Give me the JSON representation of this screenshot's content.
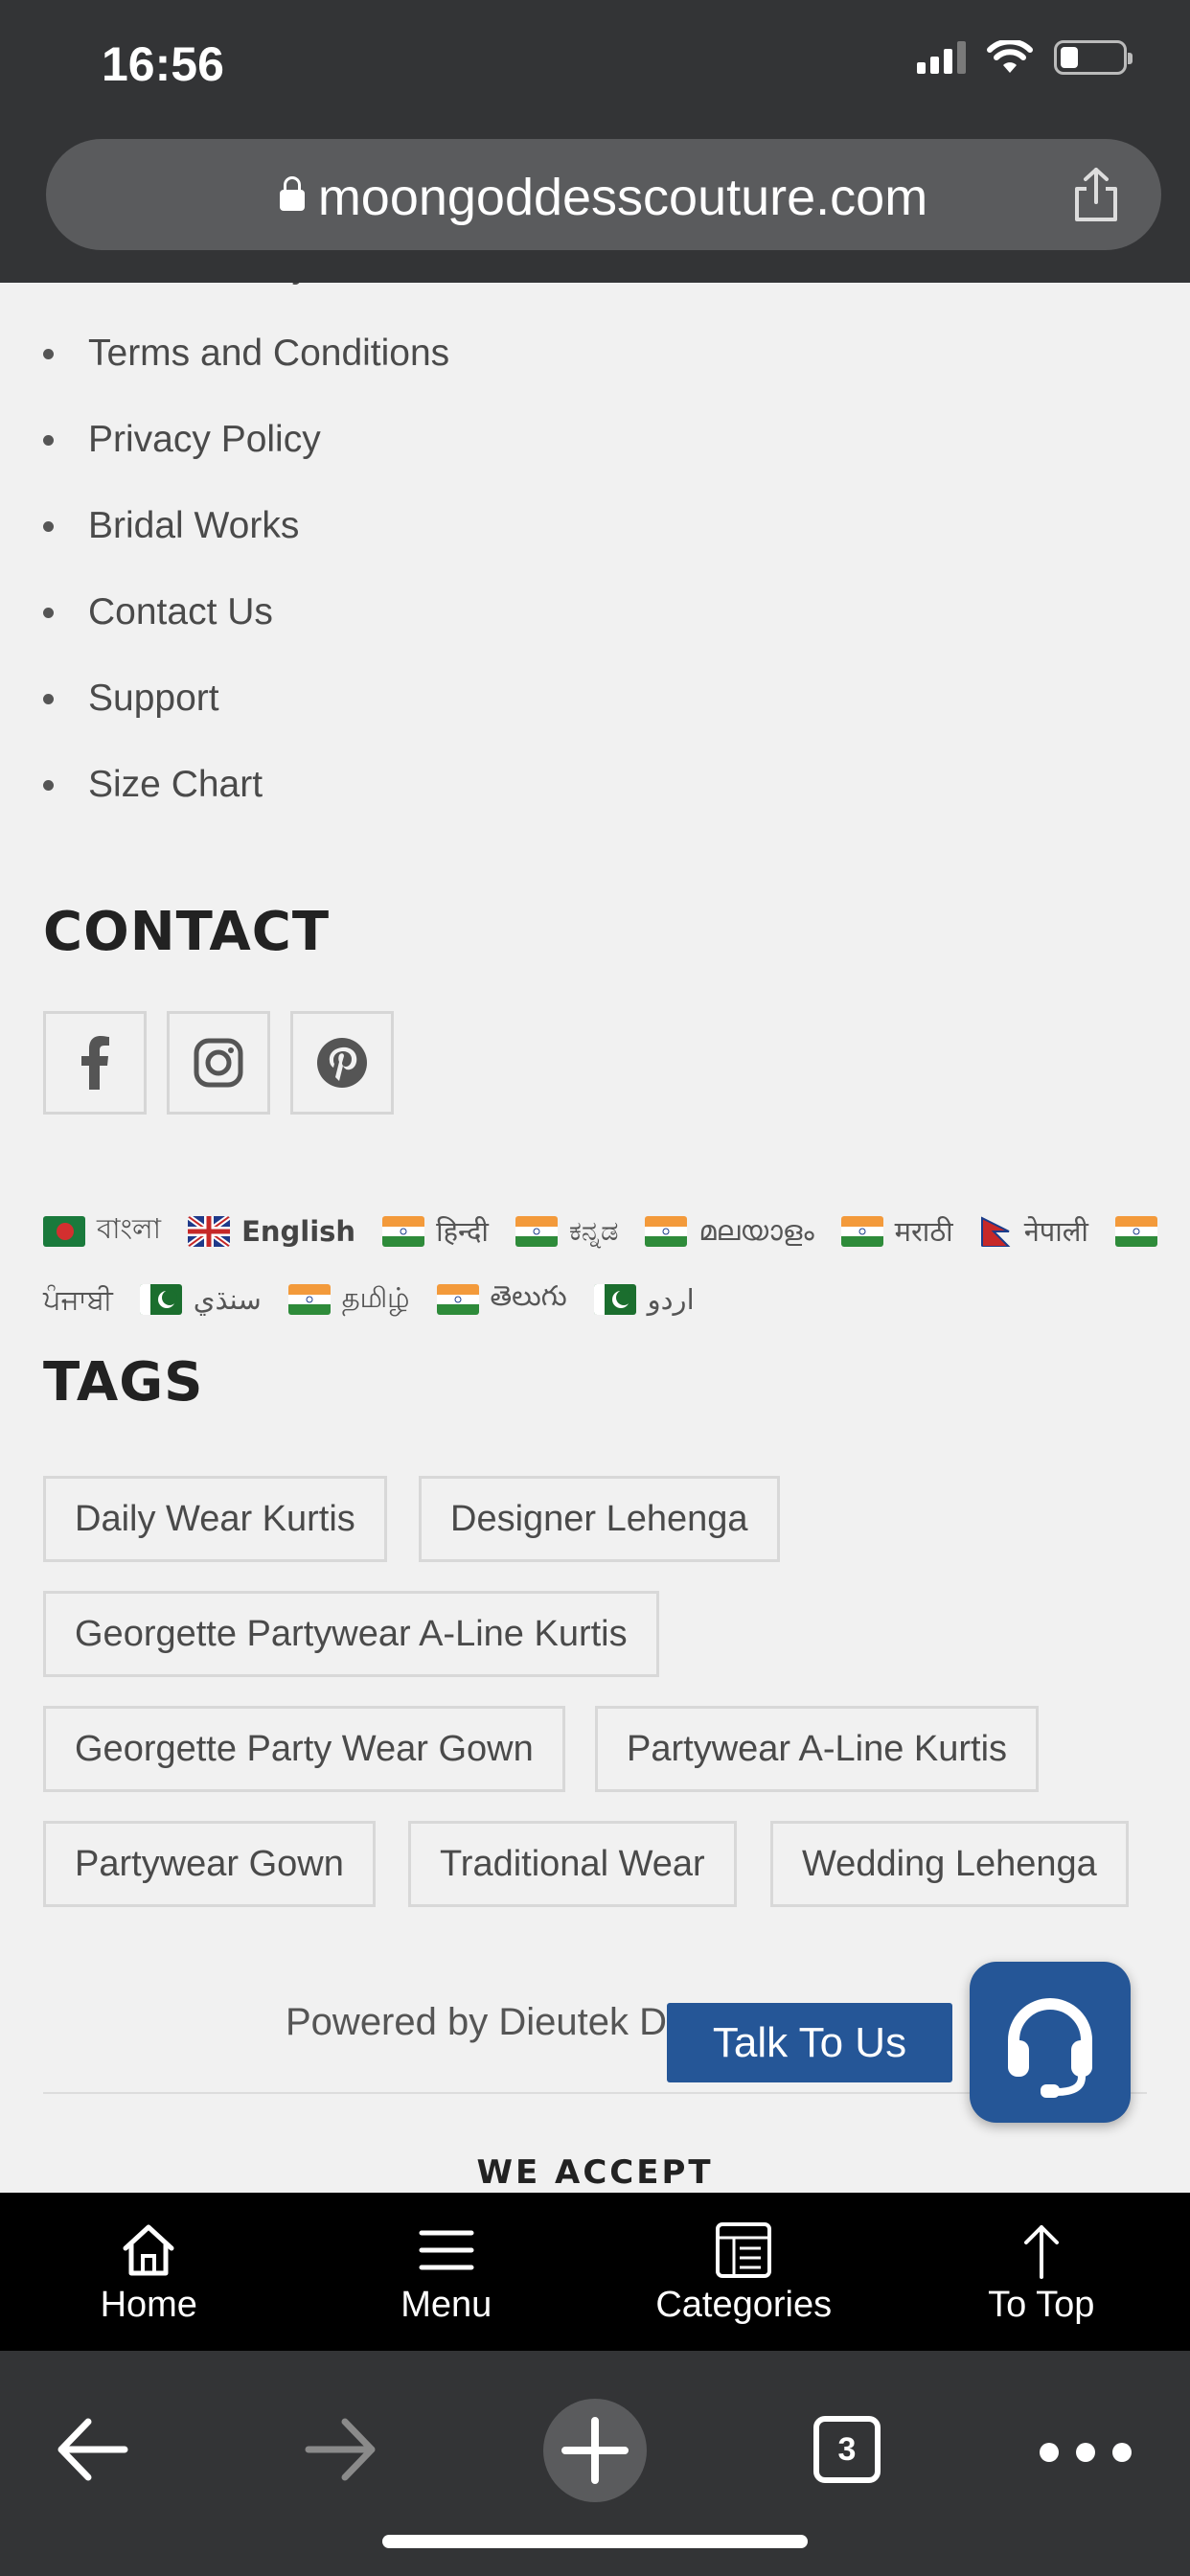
{
  "status_bar": {
    "time": "16:56"
  },
  "browser": {
    "url": "moongoddesscouture.com",
    "tab_count": "3"
  },
  "footer_links": [
    "Terms and Conditions",
    "Privacy Policy",
    "Bridal Works",
    "Contact Us",
    "Support",
    "Size Chart"
  ],
  "contact": {
    "heading": "CONTACT",
    "social": [
      "facebook-icon",
      "instagram-icon",
      "pinterest-icon"
    ]
  },
  "languages": [
    {
      "label": "বাংলা",
      "flag": "bangladesh"
    },
    {
      "label": "English",
      "flag": "uk"
    },
    {
      "label": "हिन्दी",
      "flag": "india"
    },
    {
      "label": "ಕನ್ನಡ",
      "flag": "india"
    },
    {
      "label": "മലയാളം",
      "flag": "india"
    },
    {
      "label": "मराठी",
      "flag": "india"
    },
    {
      "label": "नेपाली",
      "flag": "nepal"
    },
    {
      "label": "ਪੰਜਾਬੀ",
      "flag": "india"
    },
    {
      "label": "سنڌي",
      "flag": "pakistan"
    },
    {
      "label": "தமிழ்",
      "flag": "india"
    },
    {
      "label": "తెలుగు",
      "flag": "india"
    },
    {
      "label": "اردو",
      "flag": "pakistan"
    }
  ],
  "tags": {
    "heading": "TAGS",
    "items": [
      "Daily Wear Kurtis",
      "Designer Lehenga",
      "Georgette Partywear A-Line Kurtis",
      "Georgette Party Wear Gown",
      "Partywear A-Line Kurtis",
      "Partywear Gown",
      "Traditional Wear",
      "Wedding Lehenga"
    ]
  },
  "powered_by": "Powered by Dieutek D",
  "we_accept": "WE ACCEPT",
  "chat": {
    "label": "Talk To Us"
  },
  "site_nav": [
    {
      "label": "Home",
      "icon": "home-icon"
    },
    {
      "label": "Menu",
      "icon": "menu-icon"
    },
    {
      "label": "Categories",
      "icon": "categories-icon"
    },
    {
      "label": "To Top",
      "icon": "arrow-up-icon"
    }
  ],
  "colors": {
    "accent": "#255697",
    "page_bg": "#f1f1f1",
    "chrome": "#333436"
  }
}
